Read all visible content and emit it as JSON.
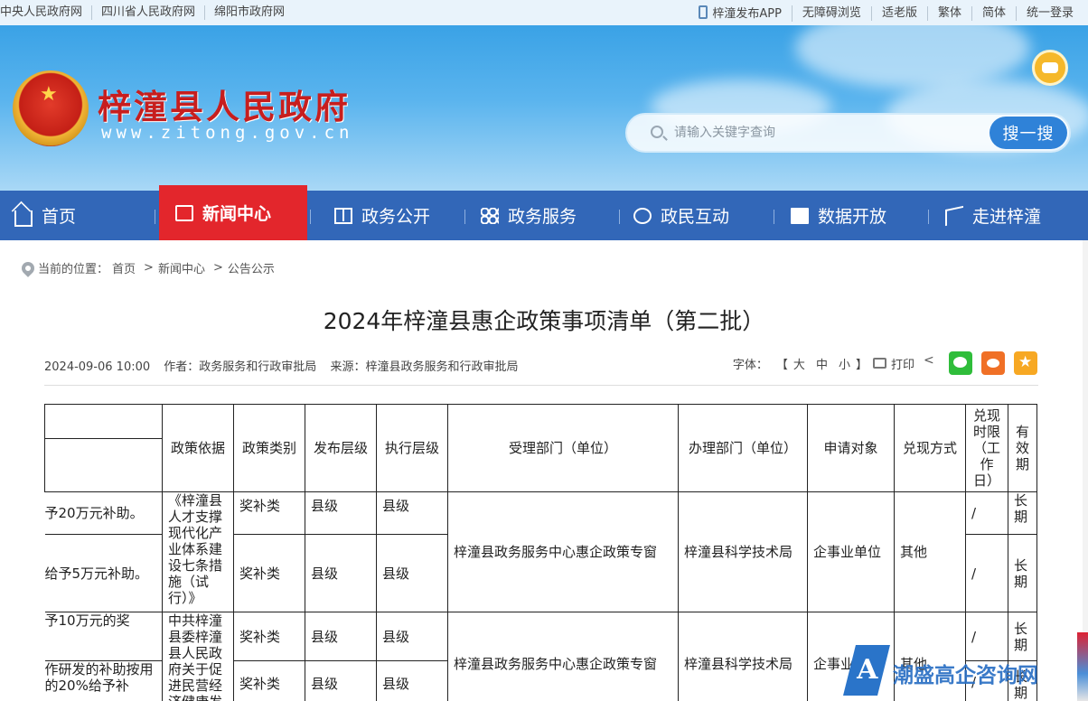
{
  "topbar": {
    "left_links": [
      "中央人民政府网",
      "四川省人民政府网",
      "绵阳市政府网"
    ],
    "right_links": [
      "梓潼发布APP",
      "无障碍浏览",
      "适老版",
      "繁体",
      "简体",
      "统一登录"
    ]
  },
  "header": {
    "site_title": "梓潼县人民政府",
    "site_url": "www.zitong.gov.cn",
    "emblem_icon": "national-emblem-icon",
    "robot_icon": "robot-assistant-icon",
    "search": {
      "placeholder": "请输入关键字查询",
      "button_label": "搜一搜"
    }
  },
  "nav": {
    "items": [
      {
        "label": "首页",
        "icon": "home-icon"
      },
      {
        "label": "新闻中心",
        "icon": "newspaper-icon",
        "active": true
      },
      {
        "label": "政务公开",
        "icon": "book-icon"
      },
      {
        "label": "政务服务",
        "icon": "grid-icon"
      },
      {
        "label": "政民互动",
        "icon": "chat-icon"
      },
      {
        "label": "数据开放",
        "icon": "data-icon"
      },
      {
        "label": "走进梓潼",
        "icon": "flag-icon"
      }
    ],
    "active_color": "#e3262c",
    "bar_color": "#3267b8"
  },
  "breadcrumb": {
    "prefix": "当前的位置：",
    "items": [
      "首页",
      "新闻中心",
      "公告公示"
    ],
    "separator": ">"
  },
  "article": {
    "title": "2024年梓潼县惠企政策事项清单（第二批）",
    "date": "2024-09-06 10:00",
    "author": "作者：政务服务和行政审批局",
    "source": "来源：梓潼县政务服务和行政审批局",
    "tools": {
      "font_label": "字体：",
      "bracket_open": "【",
      "bracket_close": "】",
      "sizes": [
        "大",
        "中",
        "小"
      ],
      "print_label": "打印"
    }
  },
  "table": {
    "headers": [
      "政策依据",
      "政策类别",
      "发布层级",
      "执行层级",
      "受理部门（单位）",
      "办理部门（单位）",
      "申请对象",
      "兑现方式",
      "兑现时限（工作日）",
      "有效期"
    ],
    "groups": [
      {
        "basis": "《梓潼县人才支撑现代化产业体系建设七条措施（试行）》",
        "accept_dept": "梓潼县政务服务中心惠企政策专窗",
        "handle_dept": "梓潼县科学技术局",
        "target": "企事业单位",
        "method": "其他",
        "rows": [
          {
            "content": "予20万元补助。",
            "category": "奖补类",
            "publish_level": "县级",
            "exec_level": "县级",
            "limit": "/",
            "validity": "长期"
          },
          {
            "content": "给予5万元补助。",
            "category": "奖补类",
            "publish_level": "县级",
            "exec_level": "县级",
            "limit": "/",
            "validity": "长期"
          }
        ]
      },
      {
        "basis": "中共梓潼县委梓潼县人民政府关于促进民营经济健康发",
        "accept_dept": "梓潼县政务服务中心惠企政策专窗",
        "handle_dept": "梓潼县科学技术局",
        "target": "企事业单位",
        "method": "其他",
        "rows": [
          {
            "content": "予10万元的奖",
            "category": "奖补类",
            "publish_level": "县级",
            "exec_level": "县级",
            "limit": "/",
            "validity": "长期"
          },
          {
            "content": "作研发的补助按用的20%给予补",
            "category": "奖补类",
            "publish_level": "县级",
            "exec_level": "县级",
            "limit": "/",
            "validity": "长期"
          }
        ]
      }
    ]
  },
  "watermark": {
    "text": "潮盛高企咨询网"
  }
}
